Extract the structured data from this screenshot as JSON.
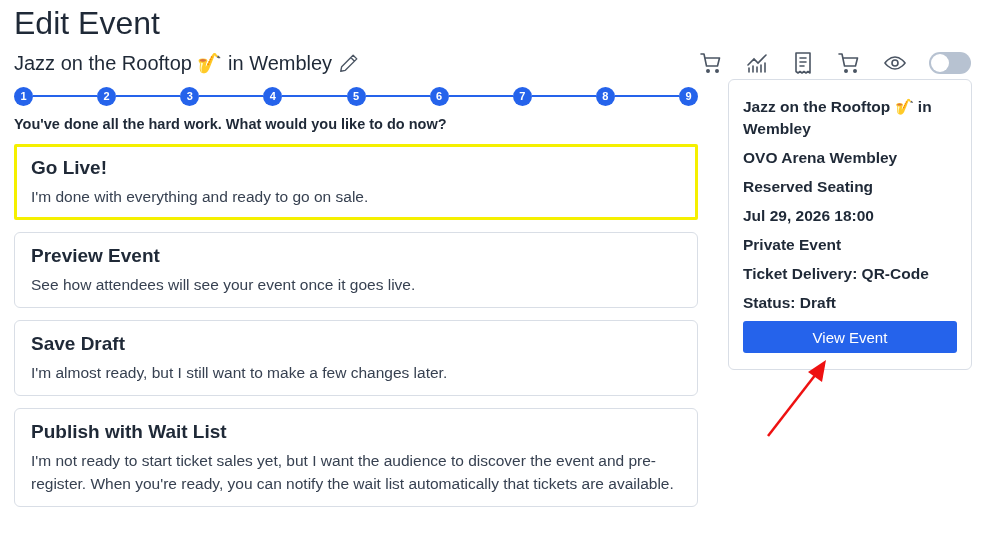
{
  "page_title": "Edit Event",
  "event_title": "Jazz on the Rooftop 🎷 in Wembley",
  "toggle": {
    "on": false
  },
  "steps": [
    {
      "label": "1",
      "done": true
    },
    {
      "label": "2",
      "done": true
    },
    {
      "label": "3",
      "done": true
    },
    {
      "label": "4",
      "done": true
    },
    {
      "label": "5",
      "done": true
    },
    {
      "label": "6",
      "done": true
    },
    {
      "label": "7",
      "done": true
    },
    {
      "label": "8",
      "done": true
    },
    {
      "label": "9",
      "done": true
    }
  ],
  "prompt": "You've done all the hard work. What would you like to do now?",
  "options": [
    {
      "title": "Go Live!",
      "description": "I'm done with everything and ready to go on sale.",
      "selected": true
    },
    {
      "title": "Preview Event",
      "description": "See how attendees will see your event once it goes live.",
      "selected": false
    },
    {
      "title": "Save Draft",
      "description": "I'm almost ready, but I still want to make a few changes later.",
      "selected": false
    },
    {
      "title": "Publish with Wait List",
      "description": "I'm not ready to start ticket sales yet, but I want the audience to discover the event and pre-register. When you're ready, you can notify the wait list automatically that tickets are available.",
      "selected": false
    }
  ],
  "summary": {
    "lines": [
      "Jazz on the Rooftop 🎷 in Wembley",
      "OVO Arena Wembley",
      "Reserved Seating",
      "Jul 29, 2026 18:00",
      "Private Event",
      "Ticket Delivery: QR-Code",
      "Status: Draft"
    ],
    "button": "View Event"
  }
}
